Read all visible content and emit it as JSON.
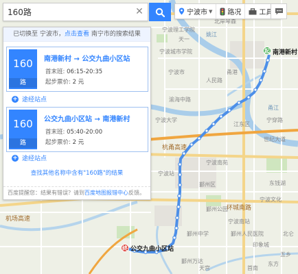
{
  "search": {
    "query": "160路"
  },
  "toolbar": {
    "city": "宁波市",
    "traffic": "路况",
    "tools": "工具"
  },
  "panel": {
    "notice_prefix": "已切换至 宁波市，",
    "notice_link": "点击查看",
    "notice_suffix": " 南宁市的搜索结果",
    "routes": [
      {
        "number": "160",
        "unit": "路",
        "from": "南港新村",
        "to": "公交九曲小区站",
        "arrow": "→",
        "first_last_label": "首末班:",
        "first_last": "06:15-20:35",
        "fare_label": "起步票价:",
        "fare": "2 元",
        "via": "途经站点"
      },
      {
        "number": "160",
        "unit": "路",
        "from": "公交九曲小区站",
        "to": "南港新村",
        "arrow": "→",
        "first_last_label": "首末班:",
        "first_last": "05:40-20:00",
        "fare_label": "起步票价:",
        "fare": "2 元",
        "via": "途经站点"
      }
    ],
    "other_routes": "查找其他名称中含有\"160路\"的结果",
    "feedback_prefix": "百度提醒您：结果有错误？请到",
    "feedback_link": "百度地图报错中心",
    "feedback_suffix": "反馈。"
  },
  "map": {
    "start_stop": "南港新村",
    "end_stop": "公交九曲小区站",
    "start_badge": "起",
    "end_badge": "终",
    "labels": [
      "宁波理工学院",
      "天一",
      "姚江",
      "北岸琴森",
      "宁波城市学院",
      "宁波市",
      "人民路",
      "渝海中路",
      "甬江",
      "甬港",
      "宁穿路",
      "江东区",
      "杭甬高速",
      "世纪大道",
      "宁波大学",
      "鄞州区",
      "鄞州公园",
      "东钱湖",
      "宁波南站",
      "机场高速",
      "宁波南苑",
      "鄞州中学",
      "宁波站",
      "环城南路",
      "印象城",
      "鄞州人民医院",
      "东方",
      "北仑",
      "首南",
      "天宫",
      "宁波文化",
      "鄞州万达",
      "五乡"
    ]
  },
  "colors": {
    "accent": "#3385ff",
    "route": "#4d8fe8",
    "start": "#2fa33b",
    "end": "#d9342b"
  },
  "icons": {
    "search": "search-icon",
    "clear": "close-icon",
    "traffic": "traffic-icon",
    "tools": "toolbox-icon",
    "message": "message-icon",
    "location": "location-icon"
  }
}
